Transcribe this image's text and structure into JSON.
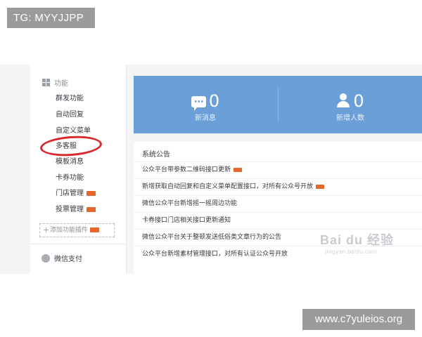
{
  "overlay": {
    "tg_label": "TG: MYYJJPP",
    "site_label": "www.c7yuleios.org"
  },
  "sidebar": {
    "section_title": "功能",
    "items": [
      {
        "label": "群发功能",
        "new": false
      },
      {
        "label": "自动回复",
        "new": false
      },
      {
        "label": "自定义菜单",
        "new": false
      },
      {
        "label": "多客服",
        "new": false,
        "highlighted": true
      },
      {
        "label": "模板消息",
        "new": false
      },
      {
        "label": "卡券功能",
        "new": false
      },
      {
        "label": "门店管理",
        "new": true
      },
      {
        "label": "投票管理",
        "new": true
      }
    ],
    "add_plugin_label": "添加功能插件",
    "pay_label": "微信支付"
  },
  "stats": {
    "new_messages": {
      "value": "0",
      "label": "新消息"
    },
    "new_followers": {
      "value": "0",
      "label": "新增人数"
    }
  },
  "notice": {
    "title": "系统公告",
    "items": [
      {
        "text": "公众平台带参数二维码接口更新",
        "new": true
      },
      {
        "text": "新增获取自动回复和自定义菜单配置接口，对所有公众号开放",
        "new": true
      },
      {
        "text": "微信公众平台新增摇一摇周边功能",
        "new": false
      },
      {
        "text": "卡券接口门店相关接口更新通知",
        "new": false
      },
      {
        "text": "微信公众平台关于整顿发送低俗类文章行为的公告",
        "new": false
      },
      {
        "text": "公众平台新增素材管理接口，对所有认证公众号开放",
        "new": false
      }
    ]
  },
  "watermark": {
    "text": "Bai du 经验",
    "sub": "jingyan.baidu.com"
  },
  "colors": {
    "stats_bg": "#6a9fd8",
    "new_tag": "#e8652a",
    "highlight_circle": "#d8282b"
  }
}
